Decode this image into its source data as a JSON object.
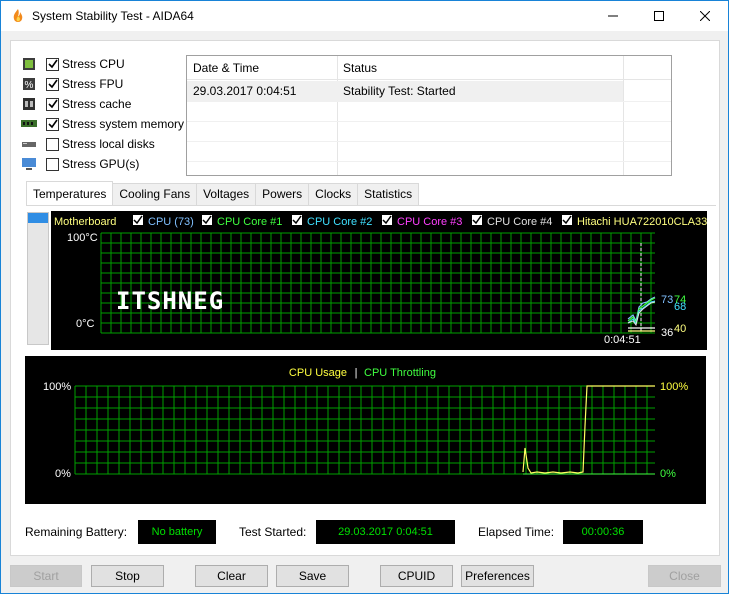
{
  "window": {
    "title": "System Stability Test - AIDA64"
  },
  "stress": [
    {
      "label": "Stress CPU",
      "checked": true,
      "icon": "cpu-chip-icon"
    },
    {
      "label": "Stress FPU",
      "checked": true,
      "icon": "fpu-percent-icon"
    },
    {
      "label": "Stress cache",
      "checked": true,
      "icon": "cache-chip-icon"
    },
    {
      "label": "Stress system memory",
      "checked": true,
      "icon": "memory-module-icon"
    },
    {
      "label": "Stress local disks",
      "checked": false,
      "icon": "disk-drive-icon"
    },
    {
      "label": "Stress GPU(s)",
      "checked": false,
      "icon": "monitor-gpu-icon"
    }
  ],
  "log": {
    "headers": [
      "Date & Time",
      "Status"
    ],
    "rows": [
      {
        "time": "29.03.2017 0:04:51",
        "status": "Stability Test: Started"
      }
    ]
  },
  "tabs": [
    "Temperatures",
    "Cooling Fans",
    "Voltages",
    "Powers",
    "Clocks",
    "Statistics"
  ],
  "active_tab": "Temperatures",
  "temperatures": {
    "legend": [
      {
        "label": "Motherboard",
        "color": "#ffff80",
        "checkbox": false
      },
      {
        "label": "CPU (73)",
        "color": "#80c0ff",
        "checkbox": true
      },
      {
        "label": "CPU Core #1",
        "color": "#40ff40",
        "checkbox": true
      },
      {
        "label": "CPU Core #2",
        "color": "#40e0ff",
        "checkbox": true
      },
      {
        "label": "CPU Core #3",
        "color": "#ff40ff",
        "checkbox": true
      },
      {
        "label": "CPU Core #4",
        "color": "#e0e0e0",
        "checkbox": true
      },
      {
        "label": "Hitachi HUA722010CLA33",
        "color": "#ffff80",
        "checkbox": true
      }
    ],
    "y_top": "100°C",
    "y_bottom": "0°C",
    "time_label": "0:04:51",
    "watermark": "ITSHNEG",
    "value_labels": [
      {
        "text": "73",
        "color": "#80c0ff"
      },
      {
        "text": "74",
        "color": "#40ff40"
      },
      {
        "text": "68",
        "color": "#40e0ff"
      },
      {
        "text": "36",
        "color": "#ffffff"
      },
      {
        "text": "40",
        "color": "#ffff80"
      }
    ]
  },
  "usage": {
    "title_usage": "CPU Usage",
    "separator": "|",
    "title_throttle": "CPU Throttling",
    "usage_color": "#ffff40",
    "throttle_color": "#40ff40",
    "left_top": "100%",
    "left_bottom": "0%",
    "right_top": "100%",
    "right_bottom": "0%"
  },
  "status": {
    "battery_label": "Remaining Battery:",
    "battery_value": "No battery",
    "started_label": "Test Started:",
    "started_value": "29.03.2017 0:04:51",
    "elapsed_label": "Elapsed Time:",
    "elapsed_value": "00:00:36"
  },
  "buttons": {
    "start": "Start",
    "stop": "Stop",
    "clear": "Clear",
    "save": "Save",
    "cpuid": "CPUID",
    "preferences": "Preferences",
    "close": "Close"
  },
  "colors": {
    "grid": "#00a000",
    "panel_bg": "#000000",
    "value_green": "#00e000",
    "window_border": "#1883d7"
  }
}
